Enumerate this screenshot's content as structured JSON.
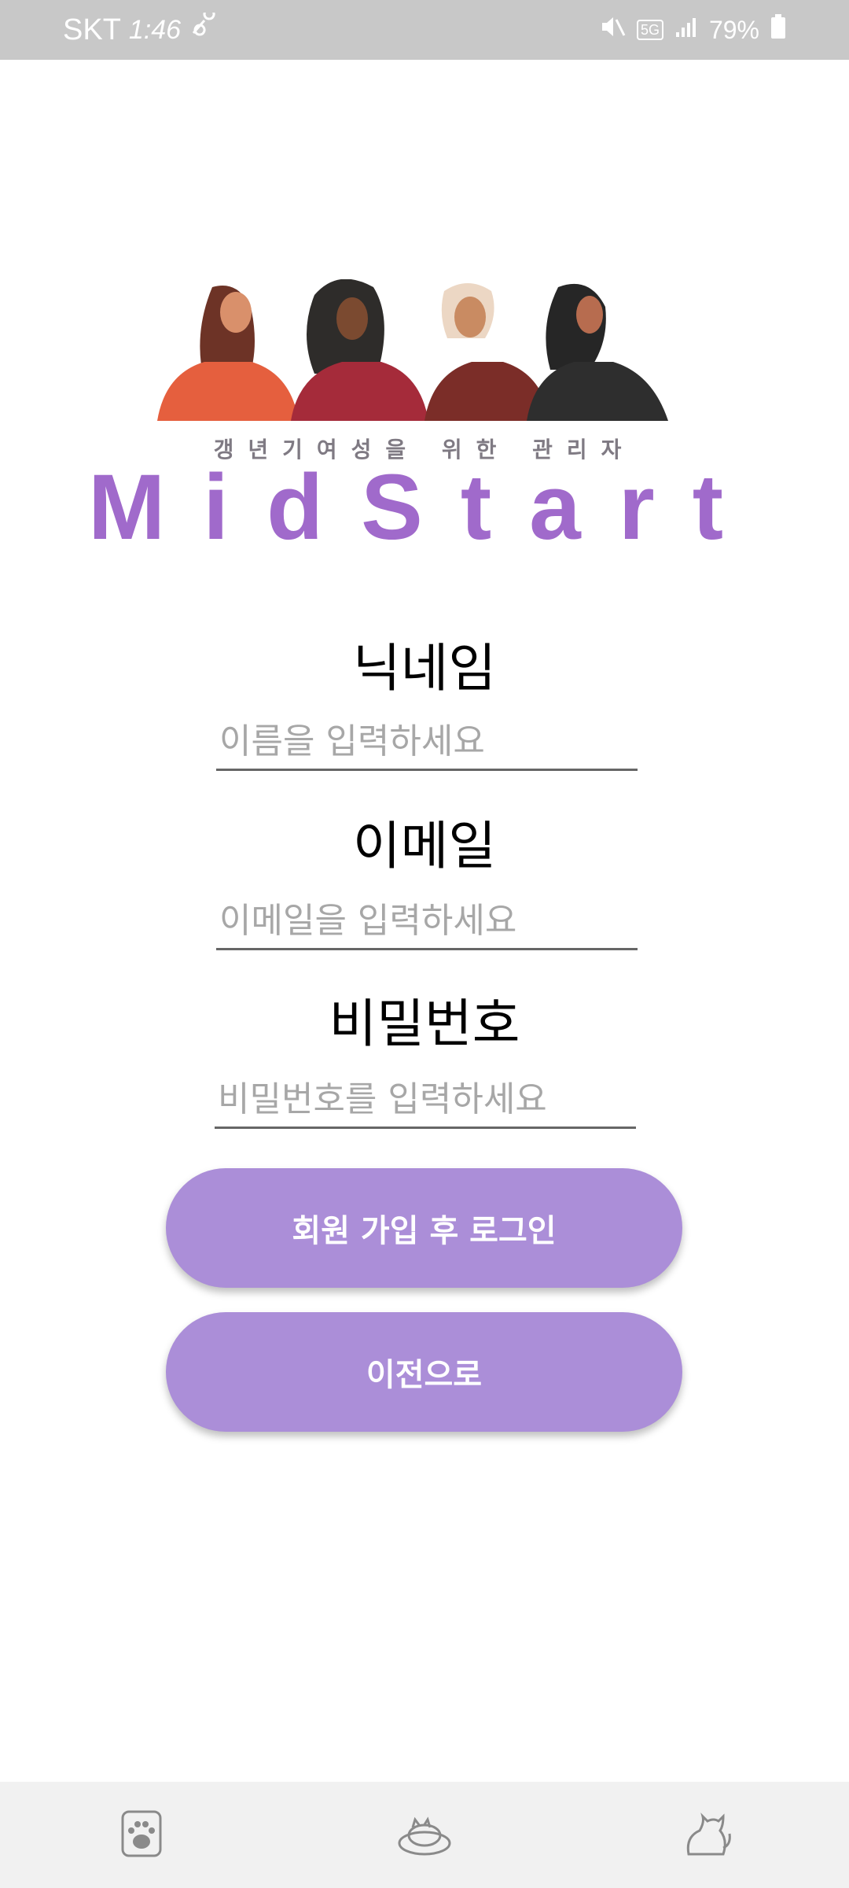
{
  "status_bar": {
    "carrier": "SKT",
    "time": "1:46",
    "network": "5G",
    "battery": "79%"
  },
  "header": {
    "subtitle": "갱년기여성을 위한 관리자",
    "logo_text": "MidStart"
  },
  "form": {
    "nickname_label": "닉네임",
    "nickname_placeholder": "이름을 입력하세요",
    "email_label": "이메일",
    "email_placeholder": "이메일을 입력하세요",
    "password_label": "비밀번호",
    "password_placeholder": "비밀번호를 입력하세요"
  },
  "buttons": {
    "signup_login": "회원 가입 후 로그인",
    "back": "이전으로"
  },
  "bottom_nav": {
    "items": [
      {
        "icon": "paw-icon"
      },
      {
        "icon": "sleeping-cat-icon"
      },
      {
        "icon": "cat-icon"
      }
    ]
  },
  "colors": {
    "accent": "#ab8ed8",
    "logo": "#a06acb",
    "status_bar": "#c8c8c8"
  }
}
